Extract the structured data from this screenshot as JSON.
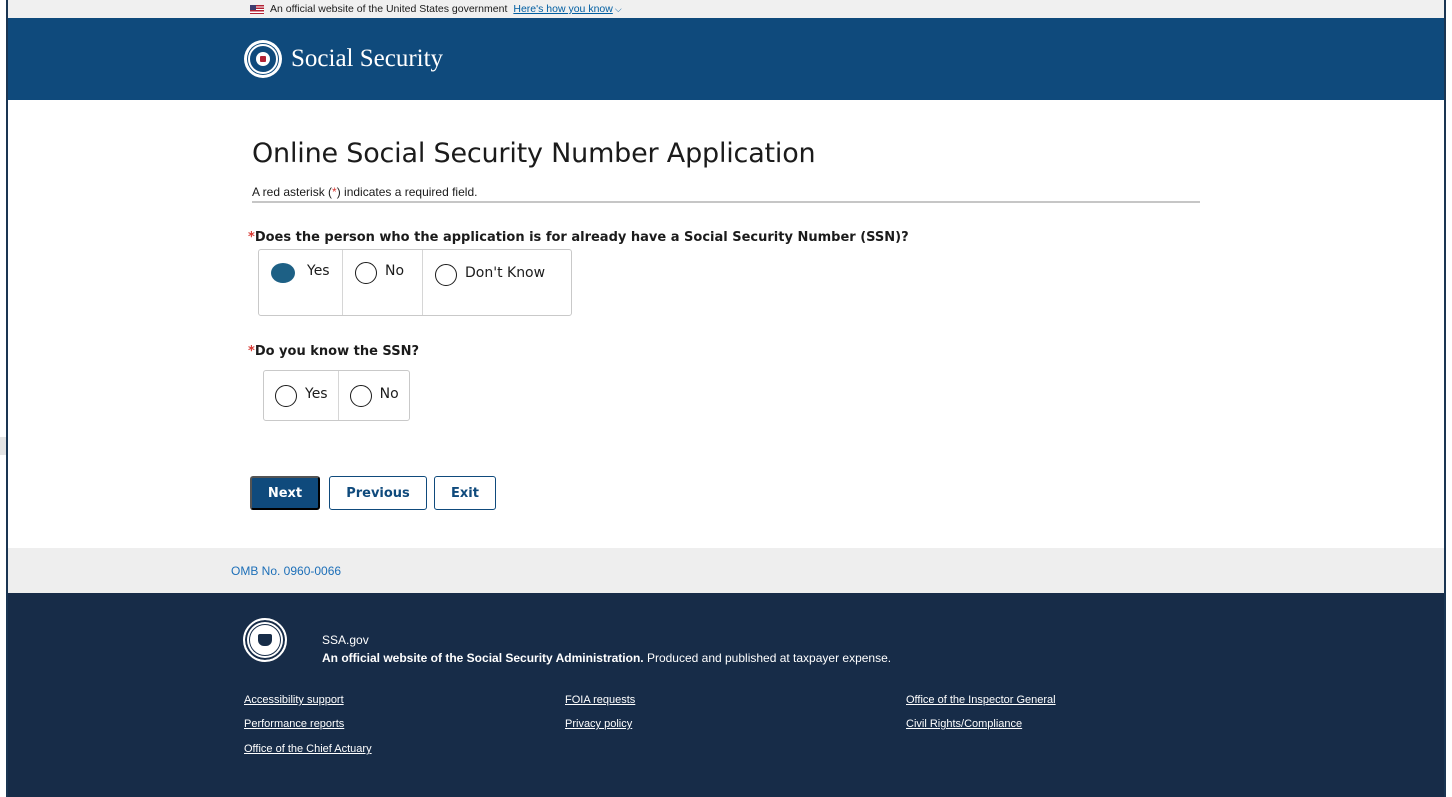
{
  "gov_banner": {
    "text": "An official website of the United States government",
    "link": "Here's how you know"
  },
  "header": {
    "brand": "Social Security"
  },
  "page": {
    "title": "Online Social Security Number Application",
    "required_note_prefix": "A red asterisk (",
    "required_note_asterisk": "*",
    "required_note_suffix": ") indicates a required field."
  },
  "question1": {
    "asterisk": "*",
    "label": "Does the person who the application is for already have a Social Security Number (SSN)?",
    "options": [
      "Yes",
      "No",
      "Don't Know"
    ],
    "selected": "Yes"
  },
  "question2": {
    "asterisk": "*",
    "label": "Do you know the SSN?",
    "options": [
      "Yes",
      "No"
    ],
    "selected": null
  },
  "buttons": {
    "next": "Next",
    "previous": "Previous",
    "exit": "Exit"
  },
  "omb": {
    "text": "OMB No. 0960-0066"
  },
  "footer": {
    "site": "SSA.gov",
    "tagline_bold": "An official website of the Social Security Administration.",
    "tagline_rest": " Produced and published at taxpayer expense.",
    "links": [
      "Accessibility support",
      "Performance reports",
      "Office of the Chief Actuary",
      "FOIA requests",
      "Privacy policy",
      "Office of the Inspector General",
      "Civil Rights/Compliance"
    ]
  },
  "colors": {
    "header_blue": "#0f4a7c",
    "footer_navy": "#172c48",
    "selected_radio": "#1d6085",
    "required_red": "#d83933",
    "link_blue": "#1d6fb8"
  }
}
